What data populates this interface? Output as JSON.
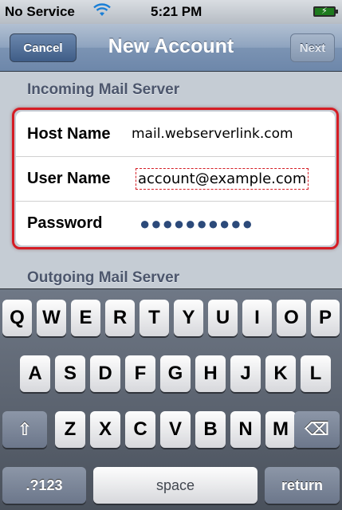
{
  "status_bar": {
    "carrier": "No Service",
    "time": "5:21 PM"
  },
  "nav": {
    "title": "New Account",
    "cancel_label": "Cancel",
    "next_label": "Next"
  },
  "incoming": {
    "header": "Incoming Mail Server",
    "fields": [
      {
        "label": "Host Name",
        "value": "mail.webserverlink.com"
      },
      {
        "label": "User Name",
        "value": "account@example.com"
      },
      {
        "label": "Password",
        "value": "●●●●●●●●●●"
      }
    ]
  },
  "outgoing": {
    "header": "Outgoing Mail Server"
  },
  "keyboard": {
    "row1": [
      "Q",
      "W",
      "E",
      "R",
      "T",
      "Y",
      "U",
      "I",
      "O",
      "P"
    ],
    "row2": [
      "A",
      "S",
      "D",
      "F",
      "G",
      "H",
      "J",
      "K",
      "L"
    ],
    "row3": [
      "Z",
      "X",
      "C",
      "V",
      "B",
      "N",
      "M"
    ],
    "shift_icon": "⇧",
    "delete_icon": "⌫",
    "numbers_label": ".?123",
    "space_label": "space",
    "return_label": "return"
  },
  "colors": {
    "highlight": "#d51c24",
    "nav_bar": "#7b93b3",
    "password_dots": "#2c4a7a"
  }
}
